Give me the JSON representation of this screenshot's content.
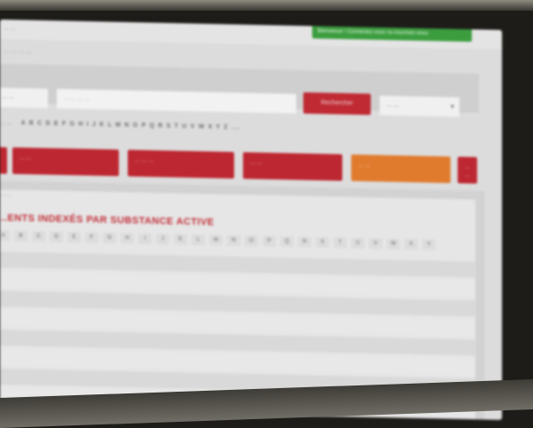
{
  "header": {
    "top_text": "... ...",
    "green_notice": "Bienvenue ! Connectez-vous ou inscrivez-vous",
    "subtitle": "... ... ... ..."
  },
  "search": {
    "left_select": "... ...",
    "input_placeholder": "... ... ... ...",
    "button_label": "Rechercher",
    "right_select": "... ...",
    "chevron_icon": "chevron-down-icon"
  },
  "alphabet": {
    "label": "... ...",
    "letters": "A B C D E F G H I J K L M N O P Q R S T U V W X Y Z ..."
  },
  "categories": [
    {
      "label": "... ..."
    },
    {
      "label": "... ... ..."
    },
    {
      "label": "... ..."
    },
    {
      "label": "... ..."
    },
    {
      "label": "... ..."
    }
  ],
  "content": {
    "small_label": "... ...",
    "title": "...ENTS INDEXÉS PAR SUBSTANCE ACTIVE",
    "letters": [
      "A",
      "B",
      "C",
      "D",
      "E",
      "F",
      "G",
      "H",
      "I",
      "J",
      "K",
      "L",
      "M",
      "N",
      "O",
      "P",
      "Q",
      "R",
      "S",
      "T",
      "U",
      "V",
      "W",
      "X",
      "Y",
      "Z"
    ]
  },
  "colors": {
    "accent_red": "#bd2731",
    "accent_orange": "#e07b2e",
    "notice_green": "#3b9d3e"
  }
}
